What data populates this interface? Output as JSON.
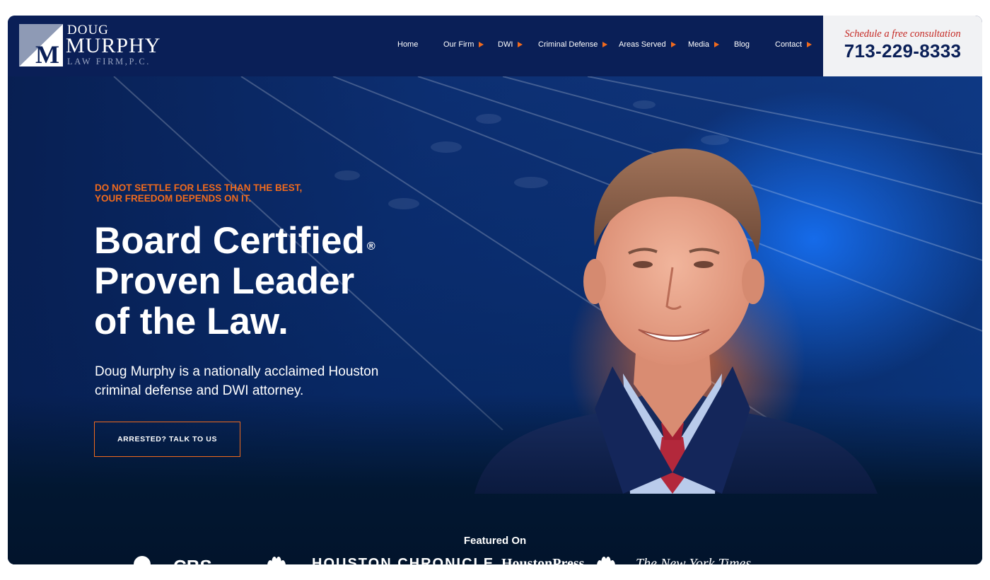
{
  "logo": {
    "line1": "DOUG",
    "line2": "MURPHY",
    "line3": "LAW FIRM,P.C.",
    "mark_letter": "M"
  },
  "nav": {
    "items": [
      {
        "label": "Home",
        "has_dropdown": false
      },
      {
        "label": "Our Firm",
        "has_dropdown": true
      },
      {
        "label": "DWI",
        "has_dropdown": true
      },
      {
        "label": "Criminal Defense",
        "has_dropdown": true
      },
      {
        "label": "Areas Served",
        "has_dropdown": true
      },
      {
        "label": "Media",
        "has_dropdown": true
      },
      {
        "label": "Blog",
        "has_dropdown": false
      },
      {
        "label": "Contact",
        "has_dropdown": true
      }
    ]
  },
  "consultation": {
    "script": "Schedule a free consultation",
    "phone": "713-229-8333"
  },
  "hero": {
    "tagline_line1": "DO NOT SETTLE FOR LESS THAN THE BEST,",
    "tagline_line2": "YOUR FREEDOM DEPENDS ON IT.",
    "headline_line1": "Board Certified",
    "headline_reg": "®",
    "headline_line2": "Proven Leader",
    "headline_line3": "of the Law.",
    "subcopy": "Doug Murphy is a nationally acclaimed Houston criminal defense and DWI attorney.",
    "button_label": "ARRESTED? TALK TO US"
  },
  "featured": {
    "heading": "Featured On",
    "logos": [
      {
        "name": "abc-logo",
        "text": "abc"
      },
      {
        "name": "cbs-logo",
        "text": "CBS"
      },
      {
        "name": "nbc-logo",
        "text": ""
      },
      {
        "name": "houston-chronicle-logo",
        "text": "HOUSTON CHRONICLE"
      },
      {
        "name": "houston-press-logo",
        "text": "HoustonPress"
      },
      {
        "name": "nbc-logo-2",
        "text": ""
      },
      {
        "name": "nyt-logo",
        "text": "The New York Times"
      }
    ]
  },
  "colors": {
    "navy": "#0a1f57",
    "accent_orange": "#f06a1d",
    "cta_red": "#c52a25",
    "cta_bg": "#f1f2f4"
  }
}
